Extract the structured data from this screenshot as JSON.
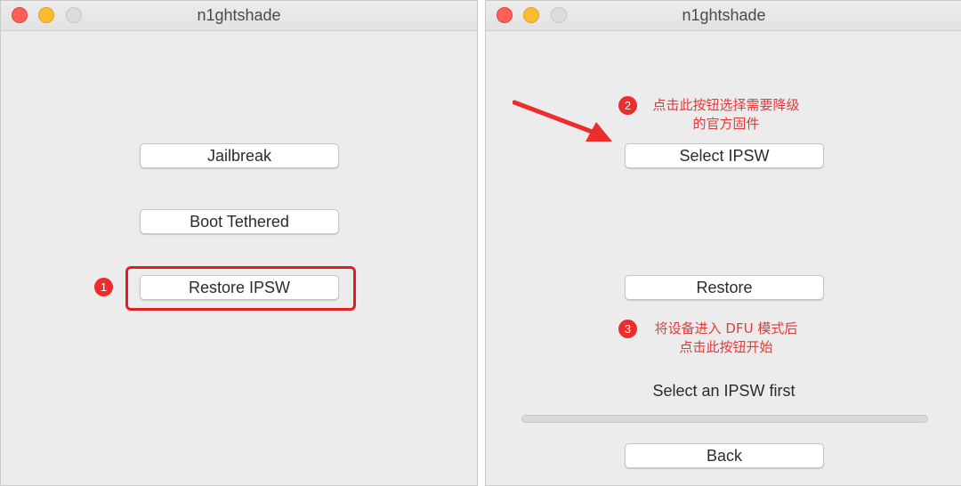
{
  "left_window": {
    "title": "n1ghtshade",
    "buttons": {
      "jailbreak": "Jailbreak",
      "boot_tethered": "Boot Tethered",
      "restore_ipsw": "Restore IPSW"
    },
    "step_badge": "1"
  },
  "right_window": {
    "title": "n1ghtshade",
    "annotation_2": {
      "badge": "2",
      "line1": "点击此按钮选择需要降级",
      "line2": "的官方固件"
    },
    "buttons": {
      "select_ipsw": "Select IPSW",
      "restore": "Restore",
      "back": "Back"
    },
    "annotation_3": {
      "badge": "3",
      "line1": "将设备进入 DFU 模式后",
      "line2": "点击此按钮开始"
    },
    "status": "Select an IPSW first",
    "progress": 0
  },
  "colors": {
    "annotation_red": "#e43a3a",
    "traffic_red": "#fe5f57",
    "traffic_yellow": "#fdbc2e"
  }
}
